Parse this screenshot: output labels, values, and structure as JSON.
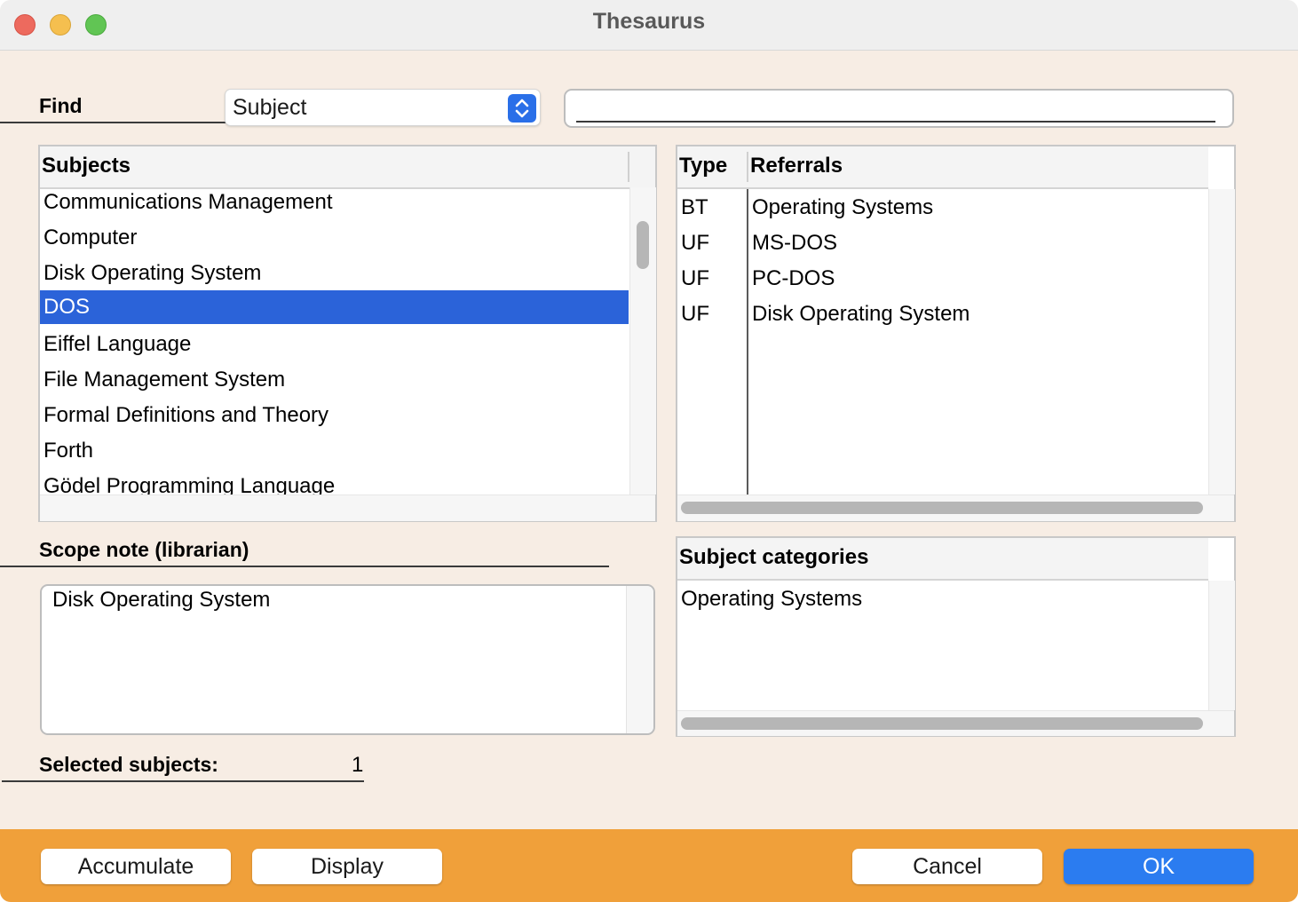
{
  "window": {
    "title": "Thesaurus"
  },
  "find": {
    "label": "Find",
    "field_selected": "Subject",
    "search_value": ""
  },
  "subjects": {
    "header": "Subjects",
    "items": [
      "Communications Management",
      "Computer",
      "Disk Operating System",
      "DOS",
      "Eiffel Language",
      "File Management System",
      "Formal Definitions and Theory",
      "Forth",
      "Gödel Programming Language"
    ],
    "selected_index": 3
  },
  "referrals": {
    "header_type": "Type",
    "header_referrals": "Referrals",
    "rows": [
      {
        "type": "BT",
        "referral": "Operating Systems"
      },
      {
        "type": "UF",
        "referral": "MS-DOS"
      },
      {
        "type": "UF",
        "referral": "PC-DOS"
      },
      {
        "type": "UF",
        "referral": "Disk Operating System"
      }
    ]
  },
  "scope_note": {
    "label": "Scope note (librarian)",
    "text": "Disk Operating System"
  },
  "subject_categories": {
    "header": "Subject categories",
    "items": [
      "Operating Systems"
    ]
  },
  "selected_subjects": {
    "label": "Selected subjects:",
    "count": "1"
  },
  "buttons": {
    "accumulate": "Accumulate",
    "display": "Display",
    "cancel": "Cancel",
    "ok": "OK"
  },
  "colors": {
    "accent": "#2b63d9",
    "footer": "#f0a03a",
    "window_bg": "#f7ede4"
  }
}
